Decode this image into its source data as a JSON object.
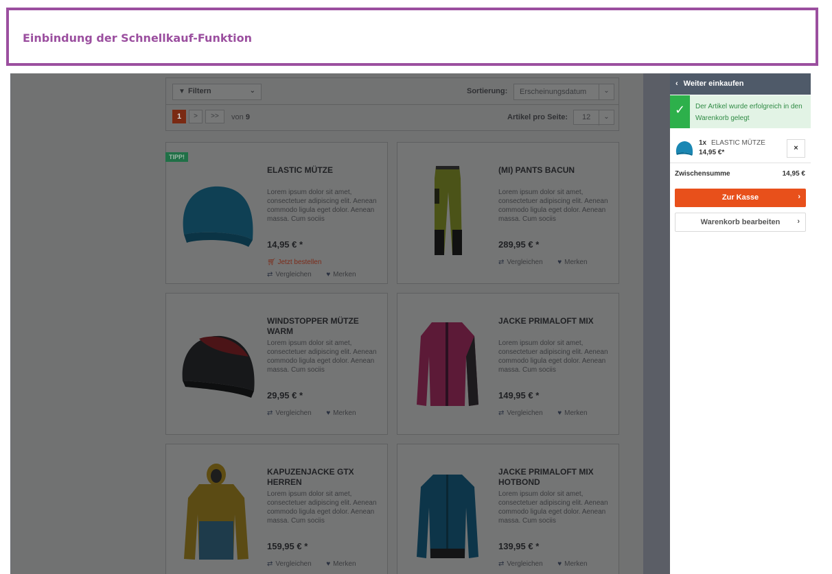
{
  "banner": {
    "title": "Einbindung der Schnellkauf-Funktion"
  },
  "toolbar": {
    "filter_label": "Filtern",
    "sort_label": "Sortierung:",
    "sort_value": "Erscheinungsdatum",
    "pagination": {
      "current": "1",
      "next": ">",
      "last": ">>",
      "of_text": "von",
      "total_pages": "9"
    },
    "per_page_label": "Artikel pro Seite:",
    "per_page_value": "12"
  },
  "products": [
    {
      "title": "ELASTIC MÜTZE",
      "badge": "TIPP!",
      "desc": "Lorem ipsum dolor sit amet, consectetuer adipiscing elit. Aenean commodo ligula eget dolor. Aenean massa. Cum sociis",
      "price": "14,95 € *",
      "order": "Jetzt bestellen",
      "compare": "Vergleichen",
      "remember": "Merken"
    },
    {
      "title": "(MI) PANTS BACUN",
      "desc": "Lorem ipsum dolor sit amet, consectetuer adipiscing elit. Aenean commodo ligula eget dolor. Aenean massa. Cum sociis",
      "price": "289,95 € *",
      "compare": "Vergleichen",
      "remember": "Merken"
    },
    {
      "title": "WINDSTOPPER MÜTZE WARM",
      "desc": "Lorem ipsum dolor sit amet, consectetuer adipiscing elit. Aenean commodo ligula eget dolor. Aenean massa. Cum sociis",
      "price": "29,95 € *",
      "compare": "Vergleichen",
      "remember": "Merken"
    },
    {
      "title": "JACKE PRIMALOFT MIX",
      "desc": "Lorem ipsum dolor sit amet, consectetuer adipiscing elit. Aenean commodo ligula eget dolor. Aenean massa. Cum sociis",
      "price": "149,95 € *",
      "compare": "Vergleichen",
      "remember": "Merken"
    },
    {
      "title": "KAPUZENJACKE GTX HERREN",
      "desc": "Lorem ipsum dolor sit amet, consectetuer adipiscing elit. Aenean commodo ligula eget dolor. Aenean massa. Cum sociis",
      "price": "159,95 € *",
      "compare": "Vergleichen",
      "remember": "Merken"
    },
    {
      "title": "JACKE PRIMALOFT MIX HOTBOND",
      "desc": "Lorem ipsum dolor sit amet, consectetuer adipiscing elit. Aenean commodo ligula eget dolor. Aenean massa. Cum sociis",
      "price": "139,95 € *",
      "compare": "Vergleichen",
      "remember": "Merken"
    }
  ],
  "cart": {
    "back_label": "Weiter einkaufen",
    "success_message": "Der Artikel wurde erfolgreich in den Warenkorb gelegt",
    "item": {
      "qty": "1x",
      "name": "ELASTIC MÜTZE",
      "price": "14,95 €*",
      "remove": "×"
    },
    "subtotal_label": "Zwischensumme",
    "subtotal_value": "14,95 €",
    "checkout_label": "Zur Kasse",
    "edit_label": "Warenkorb bearbeiten"
  },
  "colors": {
    "accent": "#9b4f9f",
    "checkout": "#e8501b",
    "success": "#2db04b",
    "cart_header": "#4f5a69"
  }
}
